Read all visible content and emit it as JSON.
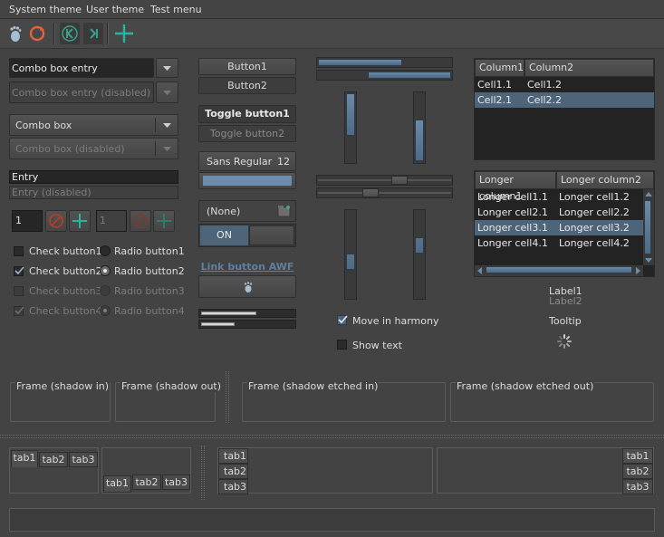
{
  "menu": {
    "items": [
      "System theme",
      "User theme",
      "Test menu"
    ]
  },
  "toolbar": {
    "icons": [
      "gnome-foot-icon",
      "refresh-icon",
      "first-icon",
      "last-icon",
      "add-icon"
    ]
  },
  "combos": {
    "entry_value": "Combo box entry",
    "entry_disabled": "Combo box entry (disabled)",
    "box_value": "Combo box",
    "box_disabled": "Combo box (disabled)"
  },
  "entries": {
    "entry": "Entry",
    "entry_disabled": "Entry (disabled)"
  },
  "spin": {
    "value1": "1",
    "value2": "1"
  },
  "checks": [
    {
      "label": "Check button1",
      "checked": false,
      "disabled": false
    },
    {
      "label": "Check button2",
      "checked": true,
      "disabled": false
    },
    {
      "label": "Check button3",
      "checked": false,
      "disabled": true
    },
    {
      "label": "Check button4",
      "checked": true,
      "disabled": true
    }
  ],
  "radios": [
    {
      "label": "Radio button1",
      "selected": false,
      "disabled": false
    },
    {
      "label": "Radio button2",
      "selected": true,
      "disabled": false
    },
    {
      "label": "Radio button3",
      "selected": false,
      "disabled": true
    },
    {
      "label": "Radio button4",
      "selected": true,
      "disabled": true
    }
  ],
  "buttons": {
    "button1": "Button1",
    "button2": "Button2",
    "toggle1": "Toggle button1",
    "toggle2": "Toggle button2",
    "font_name": "Sans Regular",
    "font_size": "12",
    "file_chooser": "(None)",
    "switch_on": "ON",
    "link": "Link button AWF"
  },
  "harmony": {
    "move_label": "Move in harmony",
    "move_checked": true,
    "show_label": "Show text",
    "show_checked": false
  },
  "tree1": {
    "columns": [
      "Column1",
      "Column2"
    ],
    "rows": [
      [
        "Cell1.1",
        "Cell1.2"
      ],
      [
        "Cell2.1",
        "Cell2.2"
      ]
    ],
    "selected_row": 1
  },
  "tree2": {
    "columns": [
      "Longer column1",
      "Longer column2"
    ],
    "rows": [
      [
        "Longer cell1.1",
        "Longer cell1.2"
      ],
      [
        "Longer cell2.1",
        "Longer cell2.2"
      ],
      [
        "Longer cell3.1",
        "Longer cell3.2"
      ],
      [
        "Longer cell4.1",
        "Longer cell4.2"
      ]
    ],
    "selected_row": 2
  },
  "labels": {
    "label1": "Label1",
    "label2": "Label2",
    "tooltip": "Tooltip"
  },
  "frames": [
    "Frame (shadow in)",
    "Frame (shadow out)",
    "Frame (shadow etched in)",
    "Frame (shadow etched out)"
  ],
  "notebooks": {
    "tabs": [
      "tab1",
      "tab2",
      "tab3"
    ]
  },
  "progress": {
    "bar1_fraction": 0.75,
    "bar2_fraction": 0.6
  },
  "colors": {
    "accent": "#6b8cab",
    "selection": "#4e6479",
    "background": "#434343"
  }
}
